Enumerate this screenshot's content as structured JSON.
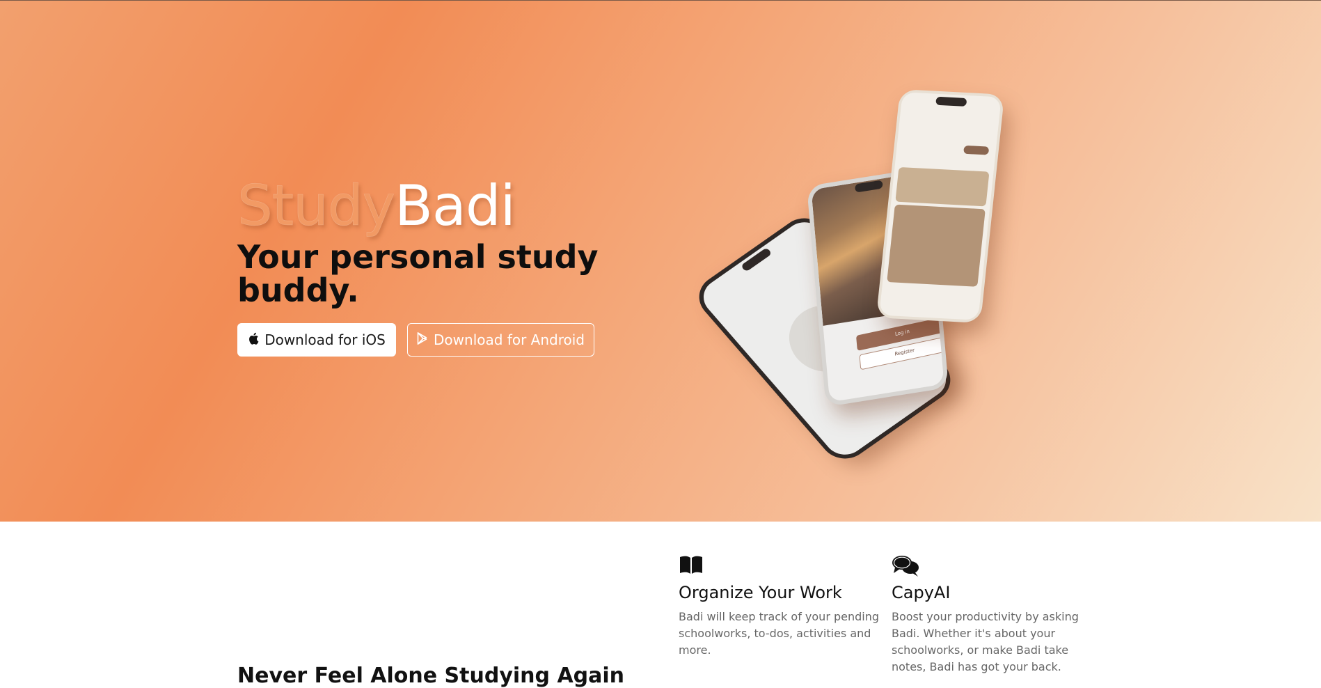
{
  "hero": {
    "brand_part1": "Study",
    "brand_part2": "Badi",
    "tagline": "Your personal study buddy.",
    "buttons": {
      "ios": "Download for iOS",
      "android": "Download for Android"
    },
    "phone_screens": {
      "login_button": "Log in",
      "register_button": "Register"
    }
  },
  "features": [
    {
      "icon": "book-open-icon",
      "title": "Organize Your Work",
      "description": "Badi will keep track of your pending schoolworks, to-dos, activities and more."
    },
    {
      "icon": "chat-bubbles-icon",
      "title": "CapyAI",
      "description": "Boost your productivity by asking Badi. Whether it's about your schoolworks, or make Badi take notes, Badi has got your back."
    }
  ],
  "section": {
    "title": "Never Feel Alone Studying Again"
  },
  "colors": {
    "hero_orange": "#f28c55",
    "hero_peach": "#f8e2c8",
    "brand_study": "#f29a64"
  }
}
